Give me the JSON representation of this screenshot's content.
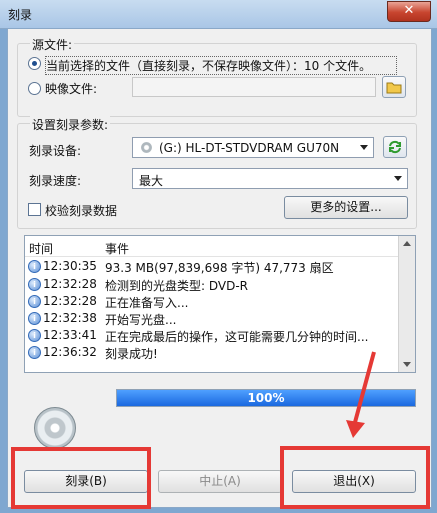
{
  "window": {
    "title": "刻录",
    "close_label": "✕"
  },
  "source": {
    "group_title": "源文件:",
    "current_option_label": "当前选择的文件（直接刻录，不保存映像文件）：10 个文件。",
    "image_option_label": "映像文件:",
    "image_path_value": ""
  },
  "settings": {
    "group_title": "设置刻录参数:",
    "device_label": "刻录设备:",
    "device_value": "(G:) HL-DT-STDVDRAM GU70N",
    "speed_label": "刻录速度:",
    "speed_value": "最大",
    "verify_label": "校验刻录数据",
    "more_settings_label": "更多的设置..."
  },
  "log": {
    "columns": [
      "时间",
      "事件"
    ],
    "rows": [
      {
        "time": "12:30:35",
        "event": "93.3 MB(97,839,698 字节)  47,773 扇区"
      },
      {
        "time": "12:32:28",
        "event": "检测到的光盘类型:  DVD-R"
      },
      {
        "time": "12:32:28",
        "event": "正在准备写入..."
      },
      {
        "time": "12:32:38",
        "event": "开始写光盘..."
      },
      {
        "time": "12:33:41",
        "event": "正在完成最后的操作，这可能需要几分钟的时间..."
      },
      {
        "time": "12:36:32",
        "event": "刻录成功!"
      }
    ]
  },
  "progress": {
    "value": 100,
    "label": "100%"
  },
  "buttons": {
    "burn": "刻录(B)",
    "stop": "中止(A)",
    "exit": "退出(X)"
  },
  "colors": {
    "annotation_red": "#e53935",
    "progress_blue": "#1a68df"
  }
}
